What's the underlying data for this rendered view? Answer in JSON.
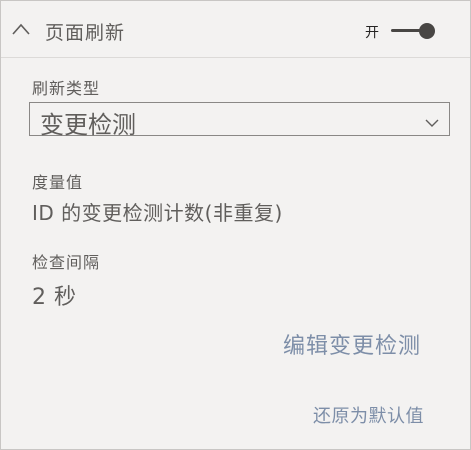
{
  "header": {
    "title": "页面刷新",
    "toggle_label": "开",
    "toggle_on": true
  },
  "refresh_type": {
    "label": "刷新类型",
    "selected": "变更检测"
  },
  "measure": {
    "label": "度量值",
    "value": "ID 的变更检测计数(非重复)"
  },
  "interval": {
    "label": "检查间隔",
    "value": "2 秒"
  },
  "links": {
    "edit": "编辑变更检测",
    "reset": "还原为默认值"
  },
  "icons": {
    "collapse": "chevron-up-icon",
    "dropdown": "chevron-down-icon"
  },
  "colors": {
    "background": "#f3f2f1",
    "text": "#605e5c",
    "link": "#7d8ea8",
    "toggle": "#484644"
  }
}
